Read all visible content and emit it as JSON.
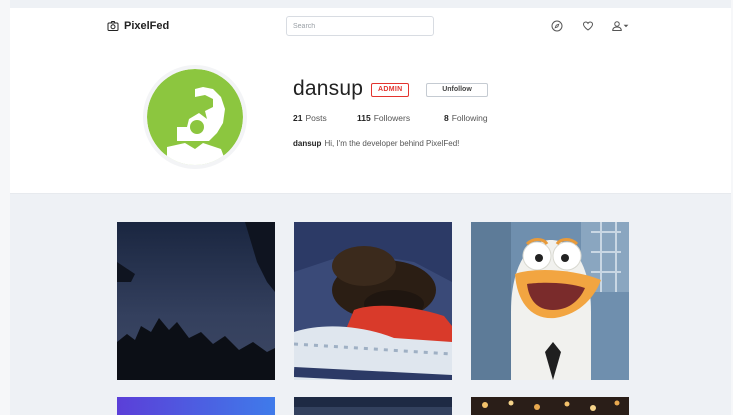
{
  "navbar": {
    "brand": "PixelFed",
    "search_placeholder": "Search",
    "icons": [
      "camera-icon",
      "explore-compass-icon",
      "heart-icon",
      "user-icon",
      "caret-down-icon"
    ]
  },
  "profile": {
    "username": "dansup",
    "badge": "ADMIN",
    "follow_button": "Unfollow",
    "stats": {
      "posts_count": "21",
      "posts_label": "Posts",
      "followers_count": "115",
      "followers_label": "Followers",
      "following_count": "8",
      "following_label": "Following"
    },
    "bio_name": "dansup",
    "bio_text": "Hi, I'm the developer behind PixelFed!"
  },
  "colors": {
    "accent_green": "#8cc63f",
    "admin_red": "#e3342f",
    "page_bg": "#eef1f5"
  },
  "posts": [
    "post-night-sky",
    "post-sleeping-puppy",
    "post-cartoon-bird",
    "post-purple-gradient",
    "post-dark-sky",
    "post-city-lights"
  ]
}
